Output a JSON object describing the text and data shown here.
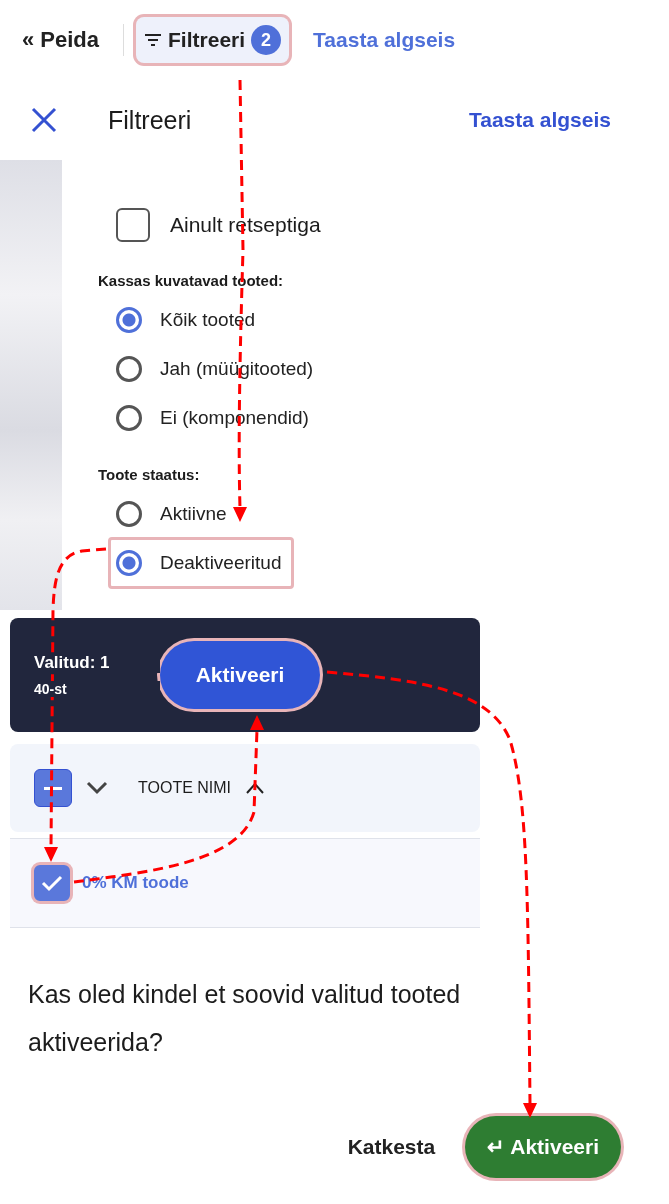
{
  "toolbar": {
    "hide": {
      "icon": "«",
      "label": "Peida"
    },
    "filter_button": {
      "label": "Filtreeri",
      "count": "2",
      "highlighted": true
    },
    "reset_link": "Taasta algseis"
  },
  "filter_panel": {
    "title": "Filtreeri",
    "reset_link": "Taasta algseis",
    "recipe_checkbox": {
      "label": "Ainult retseptiga",
      "checked": false
    },
    "groups": [
      {
        "heading": "Kassas kuvatavad tooted:",
        "options": [
          {
            "label": "Kõik tooted",
            "selected": true,
            "highlighted": false
          },
          {
            "label": "Jah (müügitooted)",
            "selected": false,
            "highlighted": false
          },
          {
            "label": "Ei (komponendid)",
            "selected": false,
            "highlighted": false
          }
        ]
      },
      {
        "heading": "Toote staatus:",
        "options": [
          {
            "label": "Aktiivne",
            "selected": false,
            "highlighted": false
          },
          {
            "label": "Deaktiveeritud",
            "selected": true,
            "highlighted": true
          }
        ]
      }
    ]
  },
  "bulk_bar": {
    "selected": "Valitud: 1",
    "total": "40-st",
    "button": {
      "label": "Aktiveeri",
      "highlighted": true
    }
  },
  "table": {
    "header": {
      "partially_selected": true,
      "column": "TOOTE NIMI"
    },
    "rows": [
      {
        "name": "0% KM toode",
        "checked": true,
        "highlighted": true
      }
    ]
  },
  "confirm": {
    "question": "Kas oled kindel et soovid valitud tooted aktiveerida?",
    "cancel": "Katkesta",
    "confirm": {
      "icon": "↵",
      "label": "Aktiveeri",
      "highlighted": true
    }
  }
}
